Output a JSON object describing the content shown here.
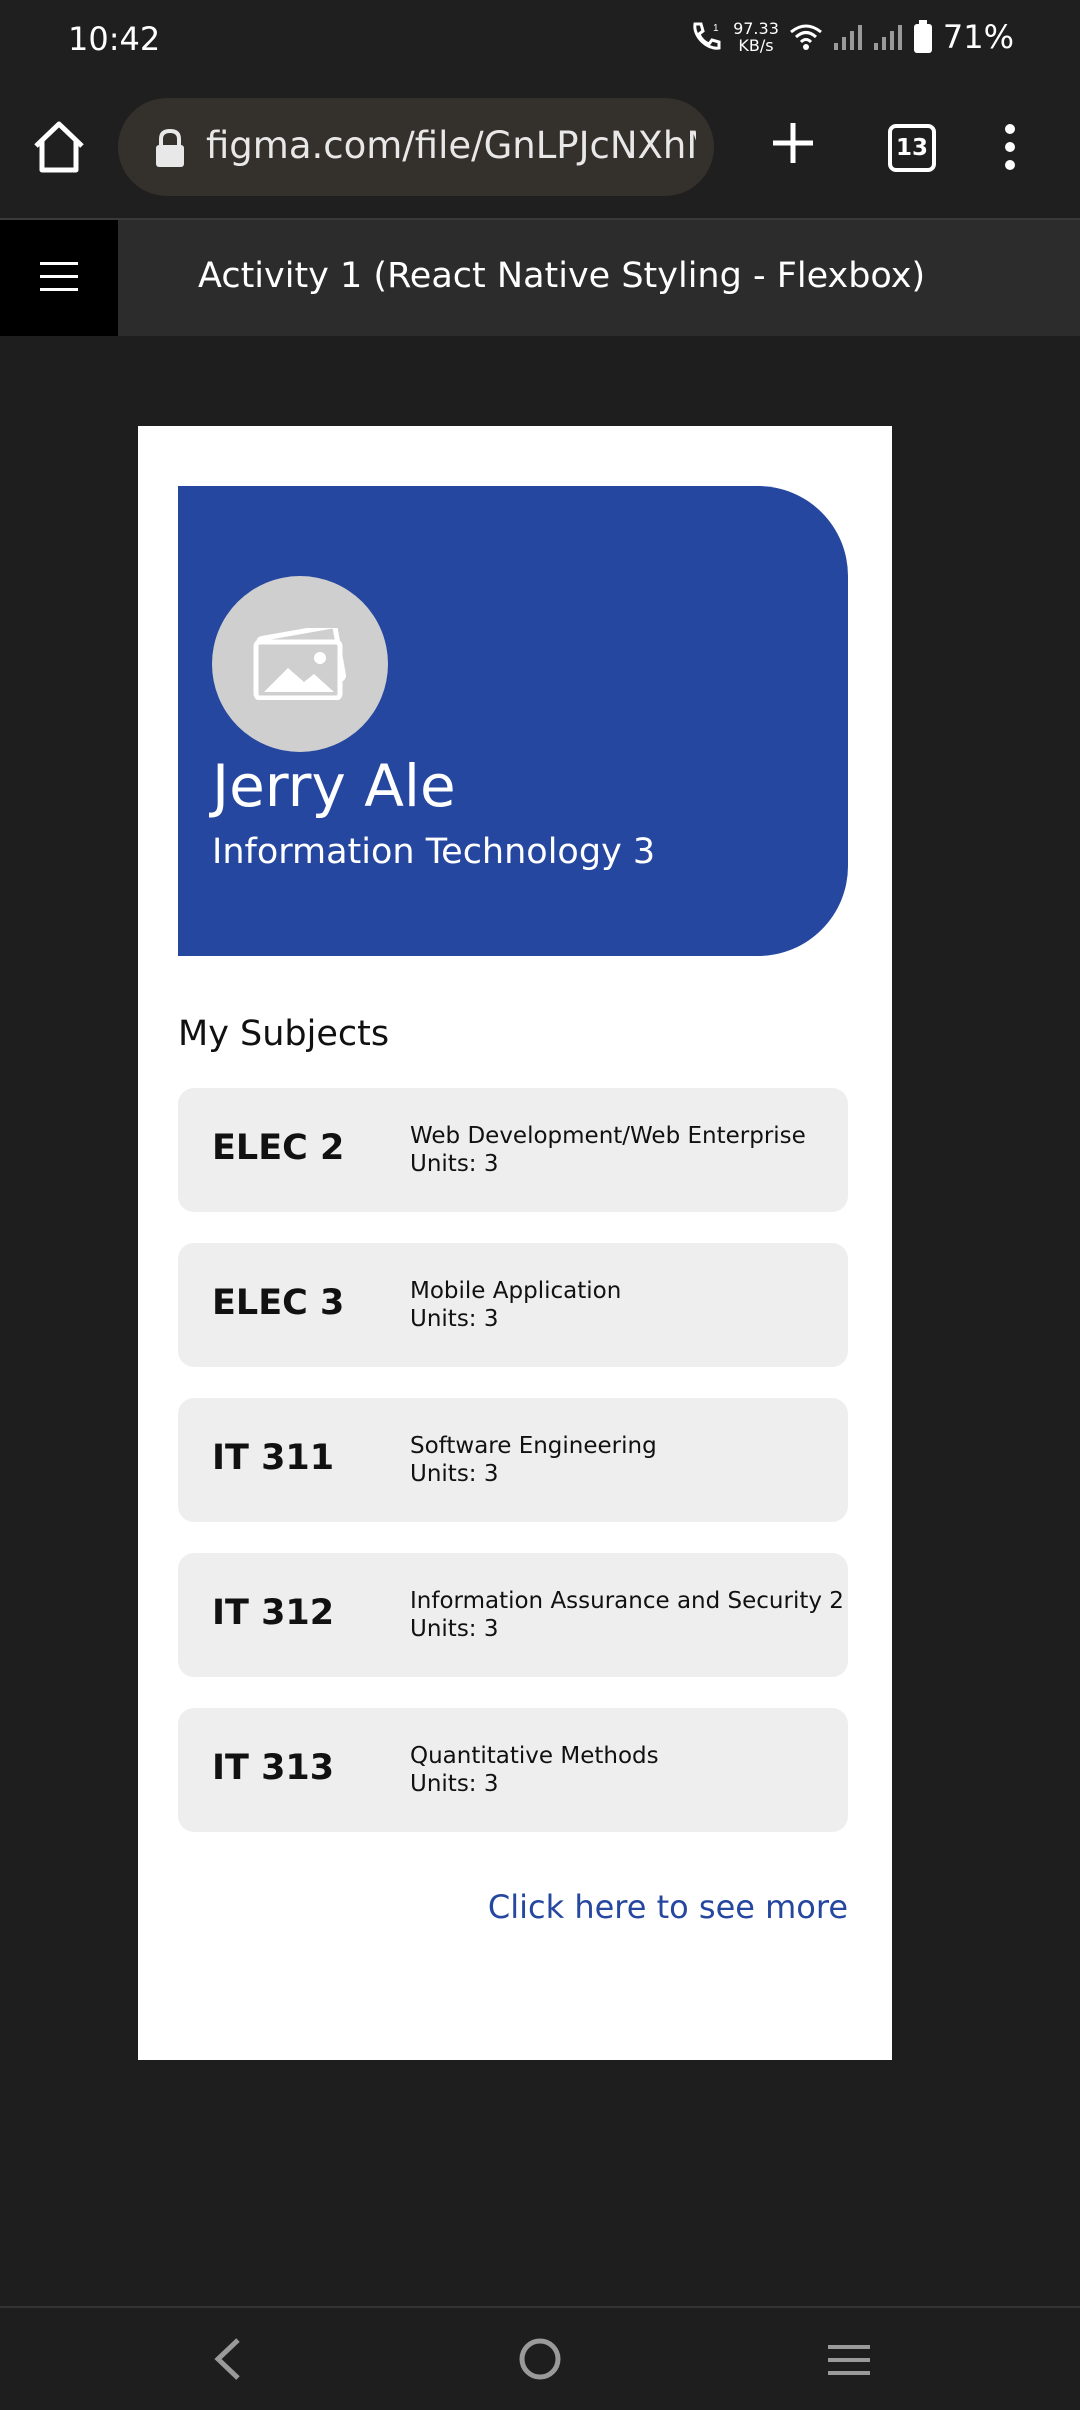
{
  "status_bar": {
    "time": "10:42",
    "speed_value": "97.33",
    "speed_unit": "KB/s",
    "battery": "71%",
    "icons": [
      "call-wifi-icon",
      "wifi-icon",
      "signal-icon",
      "signal-icon",
      "battery-icon"
    ]
  },
  "browser": {
    "url": "figma.com/file/GnLPJcNXhMM",
    "tab_count": "13",
    "icons": [
      "home-icon",
      "lock-icon",
      "plus-icon",
      "tabs-icon",
      "overflow-menu-icon"
    ]
  },
  "figma_bar": {
    "title": "Activity 1 (React Native Styling - Flexbox)",
    "icon": "hamburger-menu-icon"
  },
  "profile": {
    "name": "Jerry Ale",
    "course": "Information Technology 3",
    "avatar_icon": "image-placeholder-icon",
    "color": "#2647a0"
  },
  "subjects_section": {
    "title": "My Subjects",
    "items": [
      {
        "code": "ELEC 2",
        "title": "Web Development/Web Enterprise",
        "units": "Units: 3"
      },
      {
        "code": "ELEC 3",
        "title": "Mobile Application",
        "units": "Units: 3"
      },
      {
        "code": "IT 311",
        "title": "Software Engineering",
        "units": "Units: 3"
      },
      {
        "code": "IT 312",
        "title": "Information Assurance and Security 2",
        "units": "Units: 3"
      },
      {
        "code": "IT 313",
        "title": "Quantitative Methods",
        "units": "Units: 3"
      }
    ],
    "see_more": "Click here to see more"
  },
  "nav_bar": {
    "icons": [
      "back-icon",
      "home-circle-icon",
      "recents-icon"
    ]
  }
}
